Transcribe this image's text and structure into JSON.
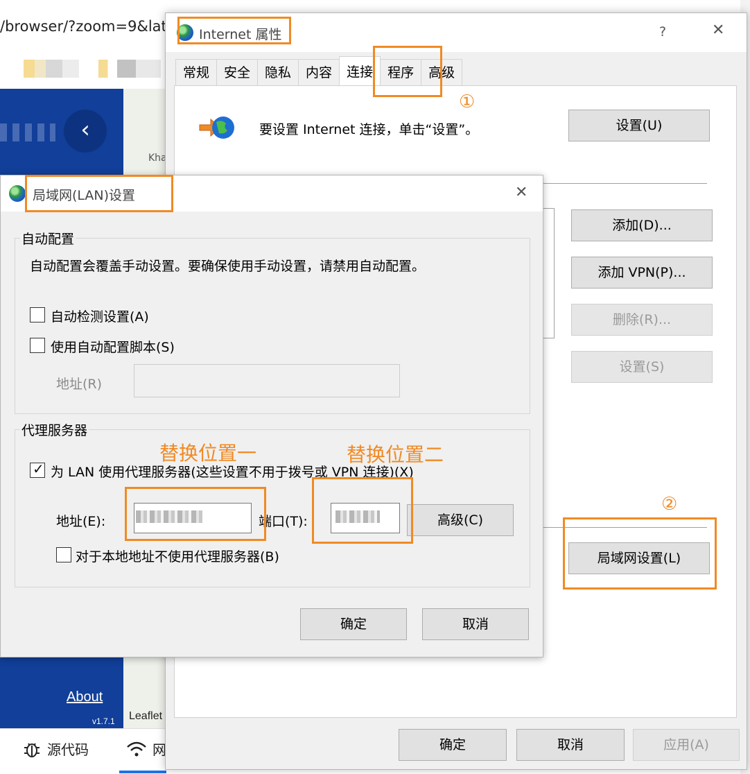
{
  "browser": {
    "url_fragment": "/browser/?zoom=9&lat",
    "back_icon": "chevron-left-icon",
    "map_label": "Kha",
    "about_link": "About",
    "version": "v1.7.1",
    "leaflet": "Leaflet",
    "devtools": {
      "tabs": [
        {
          "icon": "bug-icon",
          "label": "源代码"
        },
        {
          "icon": "wifi-icon",
          "label": "网"
        }
      ]
    }
  },
  "internet_options": {
    "title": "Internet 属性",
    "help": "?",
    "close": "✕",
    "tabs": [
      "常规",
      "安全",
      "隐私",
      "内容",
      "连接",
      "程序",
      "高级"
    ],
    "active_tab": "连接",
    "setup_text": "要设置 Internet 连接，单击“设置”。",
    "setup_button": "设置(U)",
    "add_button": "添加(D)...",
    "add_vpn_button": "添加 VPN(P)...",
    "remove_button": "删除(R)...",
    "settings_button": "设置(S)",
    "lan_settings_button": "局域网设置(L)",
    "ok": "确定",
    "cancel": "取消",
    "apply": "应用(A)"
  },
  "lan_settings": {
    "title": "局域网(LAN)设置",
    "close": "✕",
    "auto_config": {
      "label": "自动配置",
      "description": "自动配置会覆盖手动设置。要确保使用手动设置，请禁用自动配置。",
      "auto_detect": {
        "label": "自动检测设置(A)",
        "checked": false
      },
      "use_script": {
        "label": "使用自动配置脚本(S)",
        "checked": false
      },
      "address_label": "地址(R)",
      "address_value": ""
    },
    "proxy": {
      "label": "代理服务器",
      "use_proxy": {
        "label": "为 LAN 使用代理服务器(这些设置不用于拨号或 VPN 连接)(X)",
        "checked": true
      },
      "address_label": "地址(E):",
      "port_label": "端口(T):",
      "advanced_button": "高级(C)",
      "bypass_local": {
        "label": "对于本地地址不使用代理服务器(B)",
        "checked": false
      }
    },
    "ok": "确定",
    "cancel": "取消"
  },
  "annotations": {
    "step1": "①",
    "step2": "②",
    "replace1": "替换位置一",
    "replace2": "替换位置二",
    "color": "#f08a24"
  }
}
